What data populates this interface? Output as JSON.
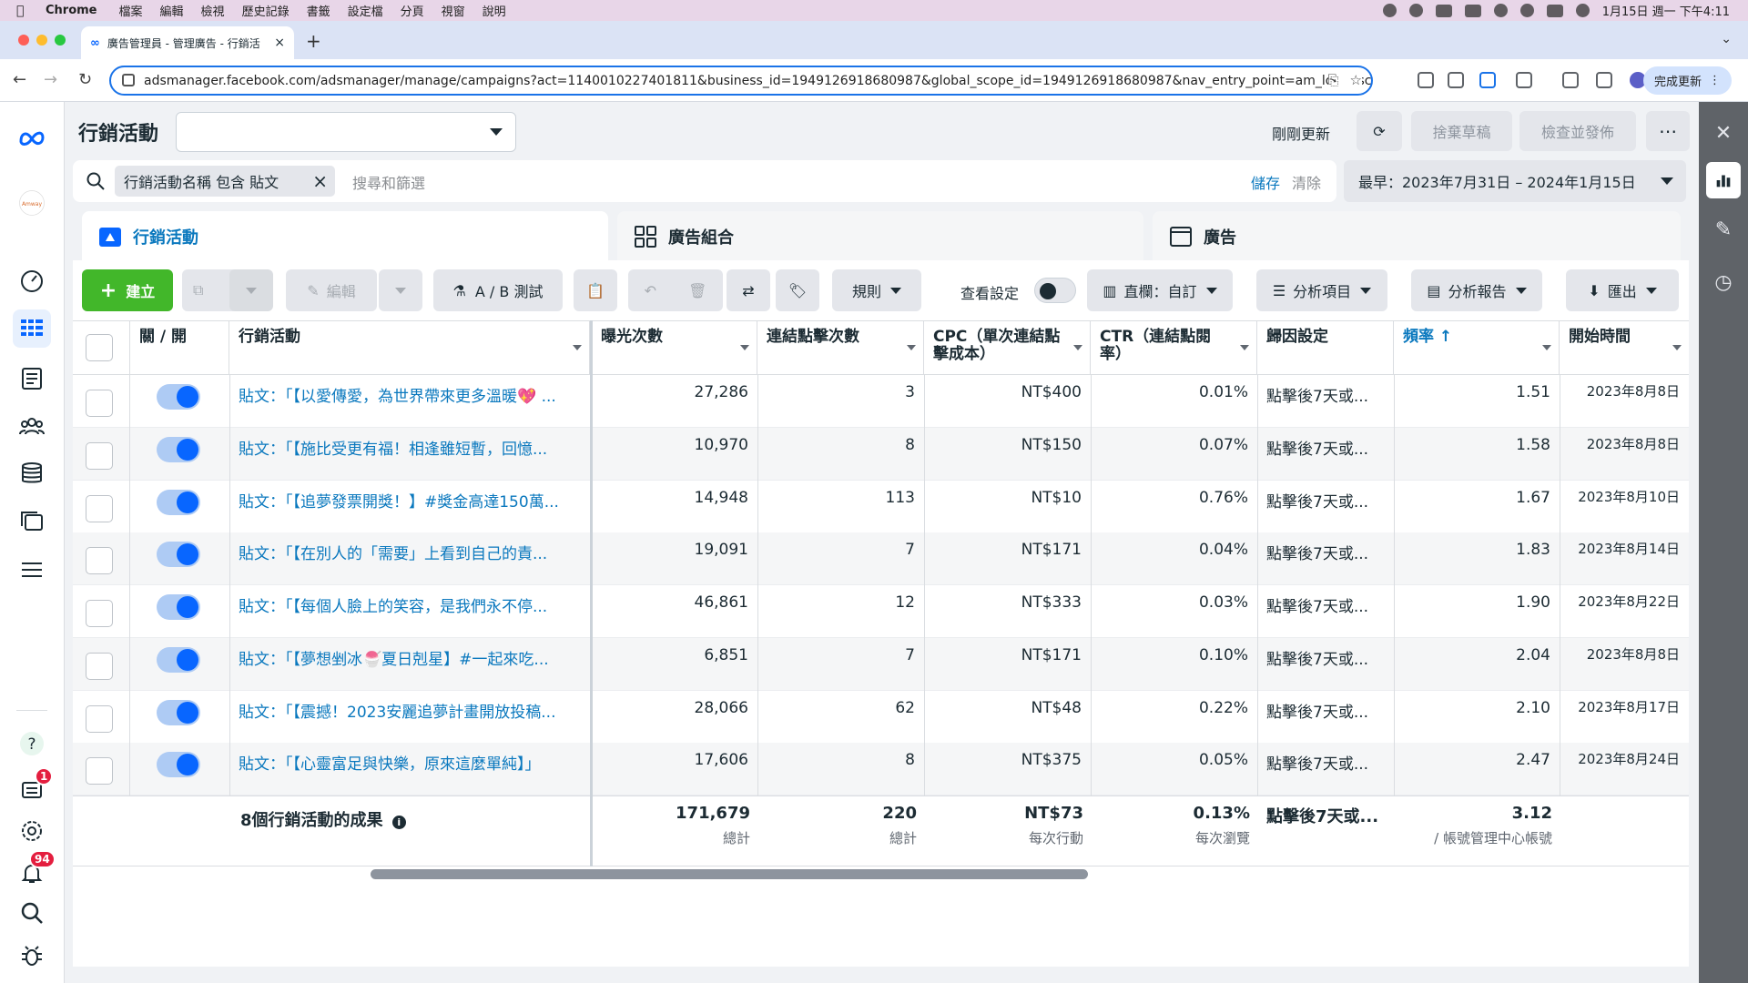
{
  "menubar": {
    "app": "Chrome",
    "items": [
      "檔案",
      "編輯",
      "檢視",
      "歷史記錄",
      "書籤",
      "設定檔",
      "分頁",
      "視窗",
      "說明"
    ],
    "clock": "1月15日 週一 下午4:11"
  },
  "browser": {
    "tab_title": "廣告管理員 - 管理廣告 - 行銷活",
    "url": "adsmanager.facebook.com/adsmanager/manage/campaigns?act=1140010227401811&business_id=1949126918680987&global_scope_id=1949126918680987&nav_entry_point=am_local_scope_s...",
    "update_button": "完成更新"
  },
  "header": {
    "title": "行銷活動",
    "updated": "剛剛更新",
    "discard": "捨棄草稿",
    "review_publish": "檢查並發佈"
  },
  "filter": {
    "chip": "行銷活動名稱 包含 貼文",
    "placeholder": "搜尋和篩選",
    "save": "儲存",
    "clear": "清除",
    "date_range": "最早：2023年7月31日 – 2024年1月15日"
  },
  "level_tabs": [
    "行銷活動",
    "廣告組合",
    "廣告"
  ],
  "toolbar": {
    "create": "建立",
    "edit": "編輯",
    "ab_test": "A / B 測試",
    "rules": "規則",
    "view_settings": "查看設定",
    "columns": "直欄：自訂",
    "breakdown": "分析項目",
    "reports": "分析報告",
    "export": "匯出"
  },
  "table": {
    "headers": {
      "onoff": "關 / 開",
      "campaign": "行銷活動",
      "impressions": "曝光次數",
      "link_clicks": "連結點擊次數",
      "cpc": "CPC（單次連結點擊成本）",
      "ctr": "CTR（連結點閱率）",
      "attribution": "歸因設定",
      "frequency": "頻率 ↑",
      "start": "開始時間"
    },
    "rows": [
      {
        "name": "貼文：「【以愛傳愛，為世界帶來更多溫暖💖 ...",
        "impressions": "27,286",
        "clicks": "3",
        "cpc": "NT$400",
        "ctr": "0.01%",
        "attribution": "點擊後7天或...",
        "frequency": "1.51",
        "start": "2023年8月8日"
      },
      {
        "name": "貼文：「【施比受更有福！相逢雖短暫，回憶...",
        "impressions": "10,970",
        "clicks": "8",
        "cpc": "NT$150",
        "ctr": "0.07%",
        "attribution": "點擊後7天或...",
        "frequency": "1.58",
        "start": "2023年8月8日"
      },
      {
        "name": "貼文：「【追夢發票開獎！】#獎金高達150萬...",
        "impressions": "14,948",
        "clicks": "113",
        "cpc": "NT$10",
        "ctr": "0.76%",
        "attribution": "點擊後7天或...",
        "frequency": "1.67",
        "start": "2023年8月10日"
      },
      {
        "name": "貼文：「【在別人的「需要」上看到自己的責...",
        "impressions": "19,091",
        "clicks": "7",
        "cpc": "NT$171",
        "ctr": "0.04%",
        "attribution": "點擊後7天或...",
        "frequency": "1.83",
        "start": "2023年8月14日"
      },
      {
        "name": "貼文：「【每個人臉上的笑容，是我們永不停...",
        "impressions": "46,861",
        "clicks": "12",
        "cpc": "NT$333",
        "ctr": "0.03%",
        "attribution": "點擊後7天或...",
        "frequency": "1.90",
        "start": "2023年8月22日"
      },
      {
        "name": "貼文：「【夢想剉冰🍧夏日剋星】#一起來吃...",
        "impressions": "6,851",
        "clicks": "7",
        "cpc": "NT$171",
        "ctr": "0.10%",
        "attribution": "點擊後7天或...",
        "frequency": "2.04",
        "start": "2023年8月8日"
      },
      {
        "name": "貼文：「【震撼！2023安麗追夢計畫開放投稿...",
        "impressions": "28,066",
        "clicks": "62",
        "cpc": "NT$48",
        "ctr": "0.22%",
        "attribution": "點擊後7天或...",
        "frequency": "2.10",
        "start": "2023年8月17日"
      },
      {
        "name": "貼文：「【心靈富足與快樂，原來這麼單純】」",
        "impressions": "17,606",
        "clicks": "8",
        "cpc": "NT$375",
        "ctr": "0.05%",
        "attribution": "點擊後7天或...",
        "frequency": "2.47",
        "start": "2023年8月24日"
      }
    ],
    "totals": {
      "label": "8個行銷活動的成果",
      "impressions": "171,679",
      "impressions_sub": "總計",
      "clicks": "220",
      "clicks_sub": "總計",
      "cpc": "NT$73",
      "cpc_sub": "每次行動",
      "ctr": "0.13%",
      "ctr_sub": "每次瀏覽",
      "attribution": "點擊後7天或...",
      "frequency": "3.12",
      "frequency_sub": "/ 帳號管理中心帳號"
    }
  },
  "leftnav": {
    "notif_badge_1": "1",
    "notif_badge_2": "94"
  },
  "colors": {
    "accent": "#0a78be",
    "create_green": "#42b72a",
    "toggle_blue": "#0866ff"
  }
}
